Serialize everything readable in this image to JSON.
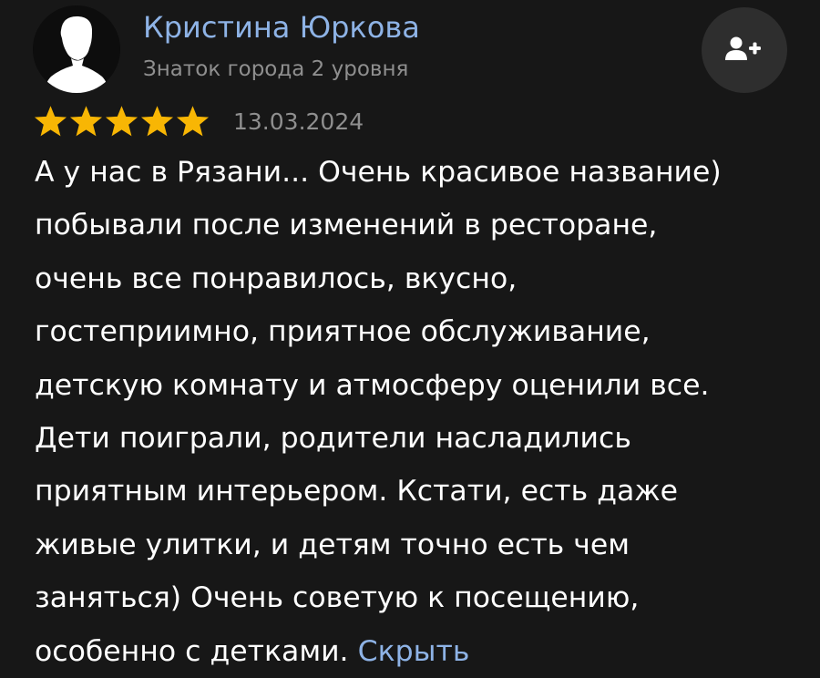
{
  "author": {
    "name": "Кристина Юркова",
    "level": "Знаток города 2 уровня"
  },
  "review": {
    "rating": 5,
    "date": "13.03.2024",
    "lines": [
      "А у нас в Рязани... Очень красивое название)",
      "побывали после изменений в ресторане,",
      "очень все понравилось, вкусно,",
      "гостеприимно, приятное обслуживание,",
      "детскую комнату и атмосферу оценили все.",
      "Дети поиграли, родители насладились",
      "приятным интерьером. Кстати, есть даже",
      "живые улитки, и детям точно есть чем",
      "заняться) Очень советую к посещению,",
      "особенно с детками. "
    ],
    "hide_label": "Скрыть"
  },
  "icons": {
    "avatar": "user-silhouette-icon",
    "subscribe": "add-user-icon",
    "star": "star-icon"
  },
  "colors": {
    "background": "#171717",
    "link": "#8eb3e6",
    "muted": "#8f8f8f",
    "star": "#f8b604",
    "button_bg": "#2e2e2e"
  }
}
